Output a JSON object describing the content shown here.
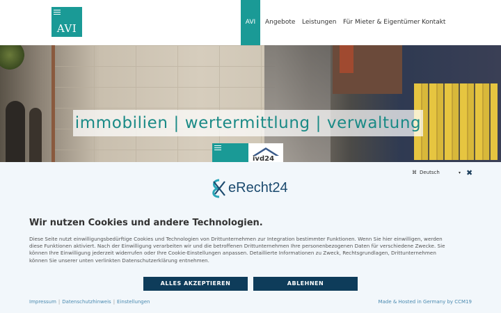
{
  "header": {
    "logo_text": "AVI",
    "nav": [
      {
        "label": "AVI",
        "active": true
      },
      {
        "label": "Angebote",
        "active": false
      },
      {
        "label": "Leistungen",
        "active": false
      },
      {
        "label": "Für Mieter & Eigentümer",
        "active": false
      },
      {
        "label": "Kontakt",
        "active": false
      }
    ]
  },
  "hero": {
    "tagline": "immobilien | wertermittlung | verwaltung",
    "badge_ivd": "ivd24"
  },
  "cookie_banner": {
    "language": "Deutsch",
    "brand": "eRecht24",
    "title": "Wir nutzen Cookies und andere Technologien.",
    "body_lines": [
      "Diese Seite nutzt einwilligungsbedürftige Cookies und Technologien von Drittunternehmen zur Integration bestimmter Funktionen. Wenn Sie hier einwilligen, werden",
      "diese Funktionen aktiviert. Nach der Einwilligung verarbeiten wir und die betroffenen Drittunternehmen Ihre personenbezogenen Daten für verschiedene Zwecke. Sie",
      "können Ihre Einwilligung jederzeit widerrufen oder Ihre Cookie-Einstellungen anpassen. Detaillierte Informationen zu Zweck, Rechtsgrundlagen, Drittunternehmen",
      "können Sie unserer unten verlinkten Datenschutzerklärung entnehmen."
    ],
    "accept_label": "ALLES AKZEPTIEREN",
    "decline_label": "ABLEHNEN",
    "links": [
      "Impressum",
      "Datenschutzhinweis",
      "Einstellungen"
    ],
    "hosted": "Made & Hosted in Germany by CCM19"
  },
  "colors": {
    "brand_teal": "#1a9a96",
    "button_navy": "#0e3c5a",
    "banner_bg": "#f2f7fb"
  }
}
